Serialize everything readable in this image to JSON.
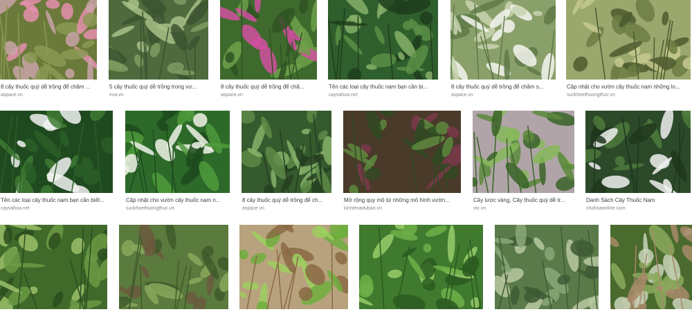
{
  "results": [
    {
      "caption": "8 cây thuốc quý dễ trồng để chăm ...",
      "source": "aspace.vn",
      "icon": "pink-flower-plant-image"
    },
    {
      "caption": "5 cây thuốc quý dễ trồng trong vư...",
      "source": "eva.vn",
      "icon": "aloe-plant-image"
    },
    {
      "caption": "8 cây thuốc quý dễ trồng để chă...",
      "source": "aspace.vn",
      "icon": "rosette-plant-pink-flower-image"
    },
    {
      "caption": "Tên các loại cây thuốc nam bạn cần bi...",
      "source": "cayvahoa.net",
      "icon": "round-leaf-plant-image"
    },
    {
      "caption": "8 cây thuốc quý dễ trồng để chăm s...",
      "source": "aspace.vn",
      "icon": "white-orchid-image"
    },
    {
      "caption": "Cập nhật cho vườn cây thuốc nam những lo...",
      "source": "suckhoethuongthuc.vn",
      "icon": "fruit-tree-branch-image"
    },
    {
      "caption": "Tên các loại cây thuốc nam bạn cần biết...",
      "source": "cayvahoa.net",
      "icon": "white-daisy-plant-image"
    },
    {
      "caption": "Cập nhật cho vườn cây thuốc nam n...",
      "source": "suckhoethuongthuc.vn",
      "icon": "white-flower-shrub-image"
    },
    {
      "caption": "8 cây thuốc quý dễ trồng để ch...",
      "source": "aspace.vn",
      "icon": "big-leaf-plant-image"
    },
    {
      "caption": "Mở rộng quy mô từ những mô hình vườn...",
      "source": "kinhtevadubao.vn",
      "icon": "purple-leaf-plant-image"
    },
    {
      "caption": "Cây lược vàng, Cây thuốc quý dễ tr...",
      "source": "vtc.vn",
      "icon": "potted-plant-image"
    },
    {
      "caption": "Danh Sách Cây Thuốc Nam",
      "source": "chohoaonline.com",
      "icon": "grass-white-flower-image"
    },
    {
      "caption": "",
      "source": "",
      "icon": "fern-leaf-plant-image"
    },
    {
      "caption": "",
      "source": "",
      "icon": "crop-field-rows-image"
    },
    {
      "caption": "",
      "source": "",
      "icon": "mint-bowl-image"
    },
    {
      "caption": "",
      "source": "",
      "icon": "mint-leaves-image"
    },
    {
      "caption": "",
      "source": "",
      "icon": "artichoke-plant-image"
    },
    {
      "caption": "",
      "source": "",
      "icon": "farmer-field-image"
    }
  ]
}
